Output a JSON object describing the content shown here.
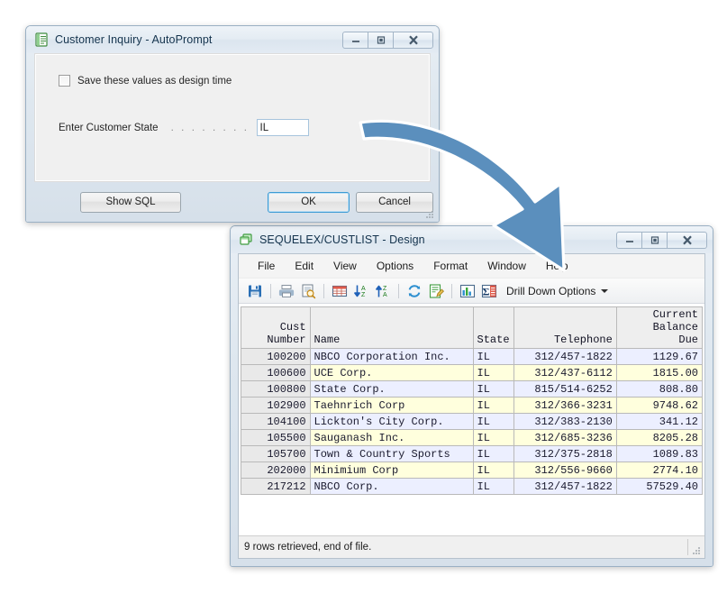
{
  "dialog": {
    "title": "Customer Inquiry - AutoPrompt",
    "icon": "green-list-document-icon",
    "window_buttons": {
      "minimize": "minimize-icon",
      "restore": "restore-icon",
      "close": "close-icon"
    },
    "checkbox": {
      "label": "Save these values as design time",
      "checked": false
    },
    "field": {
      "label": "Enter Customer State",
      "leader": ". . . . . . . .",
      "value": "IL",
      "placeholder": ""
    },
    "buttons": {
      "show_sql": "Show SQL",
      "ok": "OK",
      "cancel": "Cancel"
    }
  },
  "design_window": {
    "title": "SEQUELEX/CUSTLIST - Design",
    "icon": "green-windows-cascade-icon",
    "window_buttons": {
      "minimize": "minimize-icon",
      "restore": "restore-icon",
      "close": "close-icon"
    },
    "menu": [
      "File",
      "Edit",
      "View",
      "Options",
      "Format",
      "Window",
      "Help"
    ],
    "toolbar": {
      "icons": [
        "save-icon",
        "print-icon",
        "print-preview-icon",
        "grid-icon",
        "sort-ascending-icon",
        "sort-descending-icon",
        "refresh-icon",
        "edit-note-icon",
        "chart-icon",
        "sum-icon"
      ],
      "drill_down_label": "Drill Down Options",
      "drill_down_caret": "chevron-down-icon"
    },
    "status": "9 rows retrieved, end of file."
  },
  "table_data": {
    "type": "table",
    "columns": [
      {
        "header": [
          "Cust",
          "Number"
        ],
        "align": "right",
        "key": "cust_number"
      },
      {
        "header": [
          "",
          "Name"
        ],
        "align": "left",
        "key": "name"
      },
      {
        "header": [
          "",
          "State"
        ],
        "align": "left",
        "key": "state"
      },
      {
        "header": [
          "",
          "Telephone"
        ],
        "align": "right",
        "key": "telephone"
      },
      {
        "header": [
          "Current",
          "Balance",
          "Due"
        ],
        "align": "right",
        "key": "balance"
      }
    ],
    "rows": [
      {
        "cust_number": "100200",
        "name": "NBCO Corporation Inc.",
        "state": "IL",
        "telephone": "312/457-1822",
        "balance": "1129.67"
      },
      {
        "cust_number": "100600",
        "name": "UCE Corp.",
        "state": "IL",
        "telephone": "312/437-6112",
        "balance": "1815.00"
      },
      {
        "cust_number": "100800",
        "name": "State Corp.",
        "state": "IL",
        "telephone": "815/514-6252",
        "balance": "808.80"
      },
      {
        "cust_number": "102900",
        "name": "Taehnrich Corp",
        "state": "IL",
        "telephone": "312/366-3231",
        "balance": "9748.62"
      },
      {
        "cust_number": "104100",
        "name": "Lickton's City Corp.",
        "state": "IL",
        "telephone": "312/383-2130",
        "balance": "341.12"
      },
      {
        "cust_number": "105500",
        "name": "Sauganash Inc.",
        "state": "IL",
        "telephone": "312/685-3236",
        "balance": "8205.28"
      },
      {
        "cust_number": "105700",
        "name": "Town & Country Sports",
        "state": "IL",
        "telephone": "312/375-2818",
        "balance": "1089.83"
      },
      {
        "cust_number": "202000",
        "name": "Minimium Corp",
        "state": "IL",
        "telephone": "312/556-9660",
        "balance": "2774.10"
      },
      {
        "cust_number": "217212",
        "name": "NBCO Corp.",
        "state": "IL",
        "telephone": "312/457-1822",
        "balance": "57529.40"
      }
    ]
  },
  "annotation": {
    "arrow": "curved-arrow-icon",
    "arrow_color": "#5b8fbd"
  }
}
